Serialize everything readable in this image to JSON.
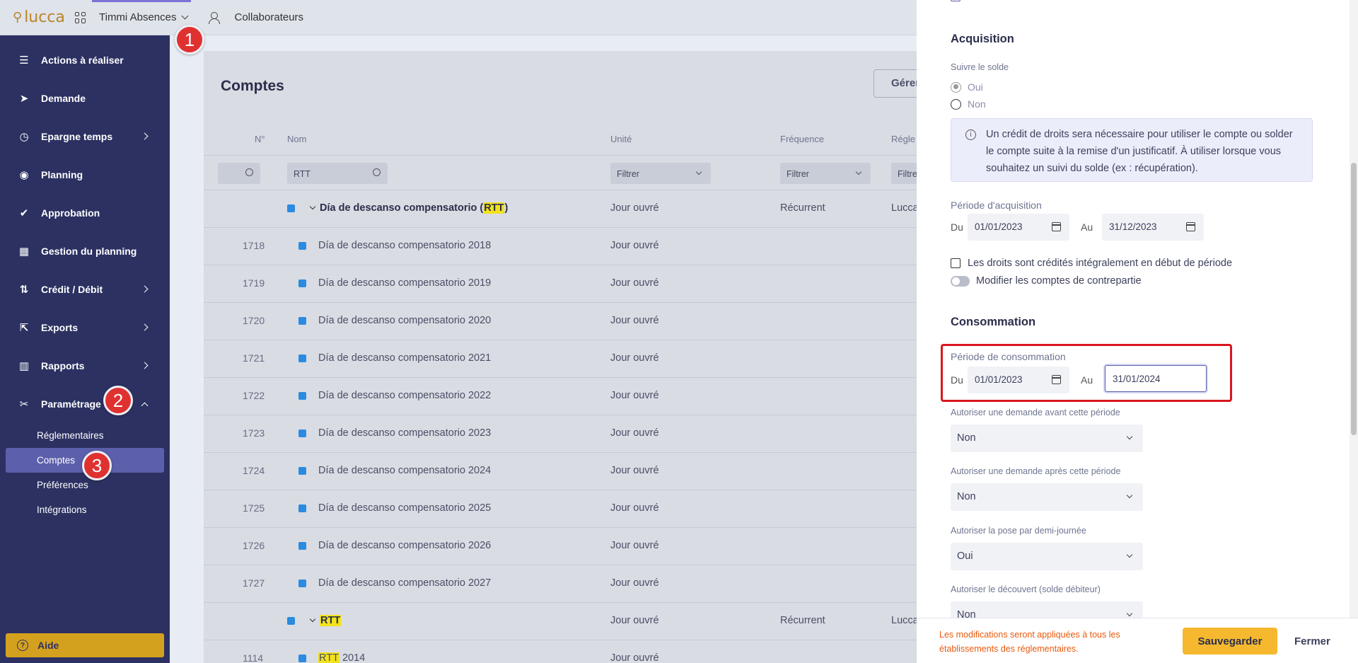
{
  "topbar": {
    "logo": "lucca",
    "app_name": "Timmi Absences",
    "collaborators": "Collaborateurs"
  },
  "sidebar": {
    "items": [
      {
        "label": "Actions à réaliser",
        "icon": "checklist-icon",
        "glyph": "☰"
      },
      {
        "label": "Demande",
        "icon": "paper-plane-icon",
        "glyph": "➤"
      },
      {
        "label": "Epargne temps",
        "icon": "clock-icon",
        "glyph": "◷"
      },
      {
        "label": "Planning",
        "icon": "eye-icon",
        "glyph": "◉"
      },
      {
        "label": "Approbation",
        "icon": "check-icon",
        "glyph": "✔"
      },
      {
        "label": "Gestion du planning",
        "icon": "calendar-icon",
        "glyph": "▦"
      },
      {
        "label": "Crédit / Débit",
        "icon": "sort-arrows-icon",
        "glyph": "⇅"
      },
      {
        "label": "Exports",
        "icon": "external-link-icon",
        "glyph": "⇱"
      },
      {
        "label": "Rapports",
        "icon": "bar-chart-icon",
        "glyph": "▥"
      },
      {
        "label": "Paramétrage",
        "icon": "settings-tools-icon",
        "glyph": "✂"
      }
    ],
    "subitems": [
      "Réglementaires",
      "Comptes",
      "Préférences",
      "Intégrations"
    ],
    "help": "Aide"
  },
  "badges": [
    "1",
    "2",
    "3"
  ],
  "main": {
    "title": "Comptes",
    "manage_button": "Gérer",
    "columns": [
      "N°",
      "Nom",
      "Unité",
      "Fréquence",
      "Régle"
    ],
    "filters": {
      "name_value": "RTT",
      "unit": "Filtrer",
      "frequency": "Filtrer",
      "regl": "Filtre"
    },
    "group1": {
      "prefix": "Día de descanso compensatorio (",
      "highlight": "RTT",
      "suffix": ")",
      "unit": "Jour ouvré",
      "frequency": "Récurrent",
      "regl": "Lucca"
    },
    "rows": [
      {
        "num": "1718",
        "name": "Día de descanso compensatorio 2018",
        "unit": "Jour ouvré"
      },
      {
        "num": "1719",
        "name": "Día de descanso compensatorio 2019",
        "unit": "Jour ouvré"
      },
      {
        "num": "1720",
        "name": "Día de descanso compensatorio 2020",
        "unit": "Jour ouvré"
      },
      {
        "num": "1721",
        "name": "Día de descanso compensatorio 2021",
        "unit": "Jour ouvré"
      },
      {
        "num": "1722",
        "name": "Día de descanso compensatorio 2022",
        "unit": "Jour ouvré"
      },
      {
        "num": "1723",
        "name": "Día de descanso compensatorio 2023",
        "unit": "Jour ouvré"
      },
      {
        "num": "1724",
        "name": "Día de descanso compensatorio 2024",
        "unit": "Jour ouvré"
      },
      {
        "num": "1725",
        "name": "Día de descanso compensatorio 2025",
        "unit": "Jour ouvré"
      },
      {
        "num": "1726",
        "name": "Día de descanso compensatorio 2026",
        "unit": "Jour ouvré"
      },
      {
        "num": "1727",
        "name": "Día de descanso compensatorio 2027",
        "unit": "Jour ouvré"
      }
    ],
    "group2": {
      "highlight": "RTT",
      "unit": "Jour ouvré",
      "frequency": "Récurrent",
      "regl": "Lucca"
    },
    "row_last": {
      "num": "1114",
      "highlight": "RTT",
      "suffix": " 2014",
      "unit": "Jour ouvré"
    }
  },
  "panel": {
    "acquisition_title": "Acquisition",
    "follow_balance_label": "Suivre le solde",
    "radio_yes": "Oui",
    "radio_no": "Non",
    "info_text": "Un crédit de droits sera nécessaire pour utiliser le compte ou solder le compte suite à la remise d'un justificatif. À utiliser lorsque vous souhaitez un suivi du solde (ex : récupération).",
    "acq_period_label": "Période d'acquisition",
    "du": "Du",
    "au": "Au",
    "acq_from": "01/01/2023",
    "acq_to": "31/12/2023",
    "credit_checkbox": "Les droits sont crédités intégralement en début de période",
    "counter_toggle": "Modifier les comptes de contrepartie",
    "consumption_title": "Consommation",
    "cons_period_label": "Période de consommation",
    "cons_from": "01/01/2023",
    "cons_to": "31/01/2024",
    "before_label": "Autoriser une demande avant cette période",
    "before_value": "Non",
    "after_label": "Autoriser une demande après cette période",
    "after_value": "Non",
    "halfday_label": "Autoriser la pose par demi-journée",
    "halfday_value": "Oui",
    "overdraft_label": "Autoriser le découvert (solde débiteur)",
    "overdraft_value": "Non",
    "footer_warning": "Les modifications seront appliquées à tous les établissements des réglementaires.",
    "save_button": "Sauvegarder",
    "close_button": "Fermer"
  },
  "colors": {
    "sidebar_bg": "#2c3162",
    "accent": "#5c5fab",
    "save": "#f5b82e",
    "badge": "#e03131",
    "highlight": "#f2e21c",
    "focus_box": "#d9161e"
  }
}
